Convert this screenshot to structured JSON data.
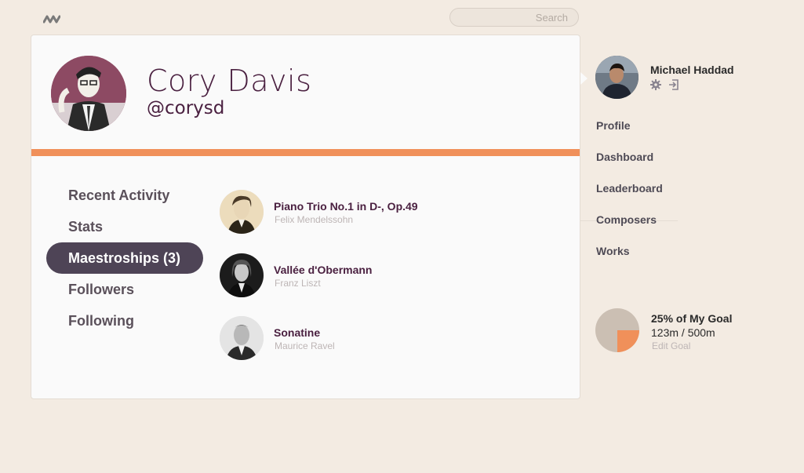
{
  "search": {
    "placeholder": "Search"
  },
  "profile": {
    "name": "Cory Davis",
    "handle": "@corysd"
  },
  "tabs": [
    {
      "label": "Recent Activity",
      "active": false
    },
    {
      "label": "Stats",
      "active": false
    },
    {
      "label": "Maestroships (3)",
      "active": true
    },
    {
      "label": "Followers",
      "active": false
    },
    {
      "label": "Following",
      "active": false
    }
  ],
  "works": [
    {
      "title": "Piano Trio No.1 in D-, Op.49",
      "composer": "Felix Mendelssohn"
    },
    {
      "title": "Vallée d'Obermann",
      "composer": "Franz Liszt"
    },
    {
      "title": "Sonatine",
      "composer": "Maurice Ravel"
    }
  ],
  "user": {
    "name": "Michael Haddad",
    "settings_icon": "gear-icon",
    "logout_icon": "logout-icon"
  },
  "nav": [
    {
      "label": "Profile"
    },
    {
      "label": "Dashboard"
    },
    {
      "label": "Leaderboard"
    },
    {
      "label": "Composers"
    },
    {
      "label": "Works"
    }
  ],
  "goal": {
    "title": "25% of My Goal",
    "progress": "123m / 500m",
    "edit_label": "Edit Goal",
    "fraction": 0.25
  },
  "colors": {
    "accent": "#f0905a",
    "active_tab": "#4e4456",
    "brand_text": "#4a2040"
  }
}
